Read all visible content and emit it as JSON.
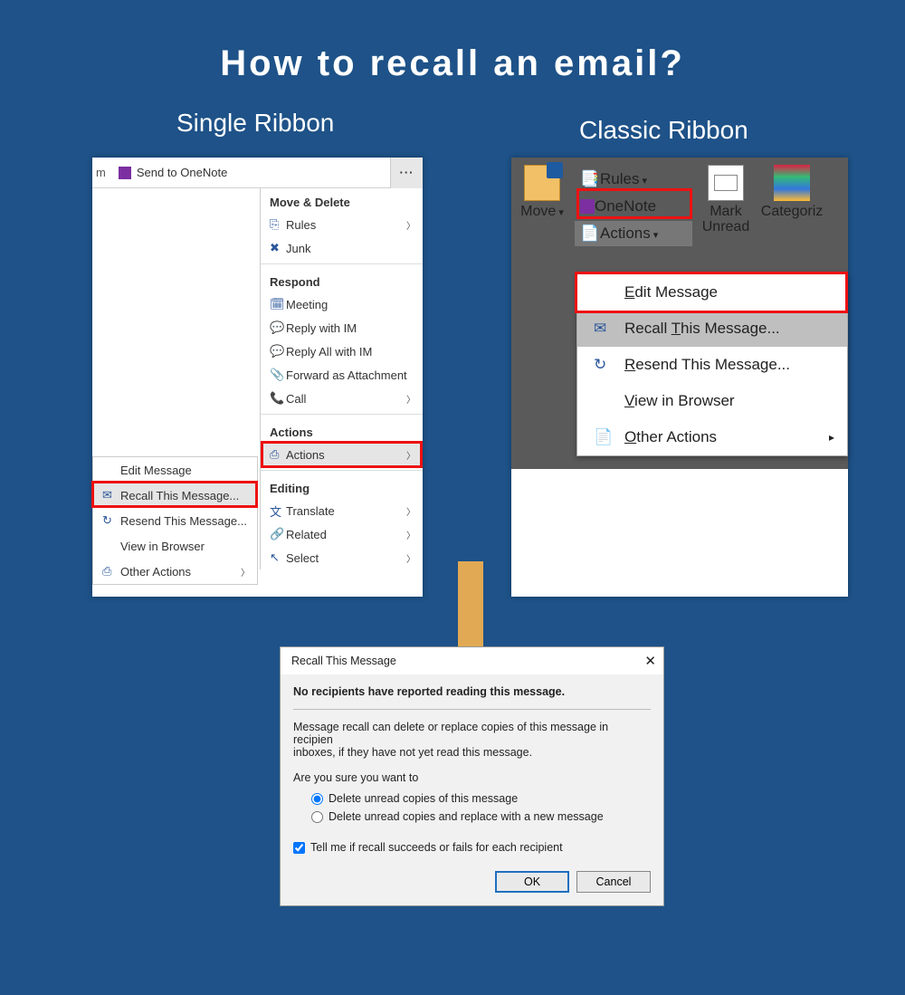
{
  "title": "How to recall an email?",
  "labels": {
    "single": "Single Ribbon",
    "classic": "Classic Ribbon"
  },
  "single": {
    "titlebar_fragment": "m",
    "send_to_onenote": "Send to OneNote",
    "dots": "···",
    "groups": {
      "move_delete": "Move & Delete",
      "respond": "Respond",
      "actions": "Actions",
      "editing": "Editing"
    },
    "items": {
      "rules": "Rules",
      "junk": "Junk",
      "meeting": "Meeting",
      "reply_im": "Reply with IM",
      "reply_all_im": "Reply All with IM",
      "forward_att": "Forward as Attachment",
      "call": "Call",
      "actions": "Actions",
      "translate": "Translate",
      "related": "Related",
      "select": "Select"
    },
    "submenu": {
      "edit": "Edit Message",
      "recall": "Recall This Message...",
      "resend": "Resend This Message...",
      "view": "View in Browser",
      "other": "Other Actions"
    }
  },
  "classic": {
    "move": "Move",
    "rules": "Rules",
    "onenote": "OneNote",
    "actions": "Actions",
    "mark_unread": "Mark\nUnread",
    "categorize": "Categoriz",
    "drop": {
      "edit": "Edit Message",
      "recall": "Recall This Message...",
      "resend": "Resend This Message...",
      "view": "View in Browser",
      "other": "Other Actions"
    }
  },
  "dialog": {
    "title": "Recall This Message",
    "status": "No recipients have reported reading this message.",
    "explain_l1": "Message recall can delete or replace copies of this message in recipien",
    "explain_l2": "inboxes, if they have not yet read this message.",
    "prompt": "Are you sure you want to",
    "opt1": "Delete unread copies of this message",
    "opt2": "Delete unread copies and replace with a new message",
    "check": "Tell me if recall succeeds or fails for each recipient",
    "ok": "OK",
    "cancel": "Cancel"
  }
}
